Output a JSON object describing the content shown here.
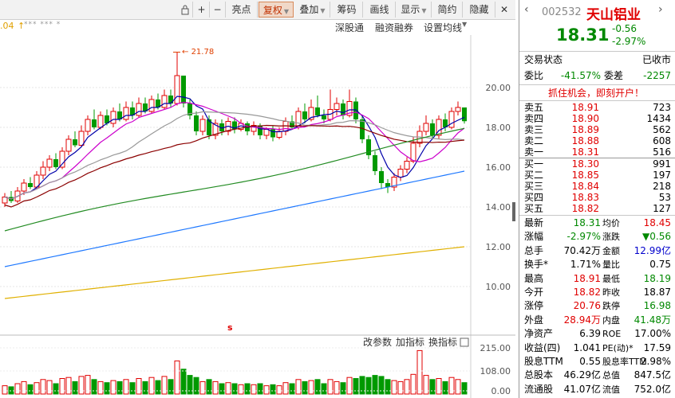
{
  "toolbar": {
    "items": [
      {
        "label": "亮点"
      },
      {
        "label": "复权",
        "active": true
      },
      {
        "label": "叠加"
      },
      {
        "label": "筹码"
      },
      {
        "label": "画线"
      },
      {
        "label": "显示"
      },
      {
        "label": "简约"
      },
      {
        "label": "隐藏"
      }
    ]
  },
  "subbar": {
    "price_marker": ".04",
    "items": [
      "深股通",
      "融资融券",
      "设置均线"
    ]
  },
  "chart": {
    "y_ticks": [
      "20.00",
      "18.00",
      "16.00",
      "14.00",
      "12.00",
      "10.00"
    ],
    "high_label": "21.78",
    "marker": "s",
    "volume_tabs": [
      "改参数",
      "加指标",
      "换指标"
    ],
    "vol_ticks": [
      "215.00",
      "108.00",
      "0.00"
    ],
    "colors": {
      "up": "#e00000",
      "down": "#009900",
      "ma5": "#0000aa",
      "ma10": "#cc00cc",
      "ma20": "#999999",
      "ma30": "#8b0000",
      "ma60": "#228b22",
      "ma120": "#1e78ff",
      "ma250": "#e0b000"
    }
  },
  "quote": {
    "code": "002532",
    "name": "天山铝业",
    "price": "18.31",
    "change": "-0.56",
    "change_pct": "-2.97%",
    "status_label": "交易状态",
    "status_value": "已收市",
    "weibi_label": "委比",
    "weibi_value": "-41.57%",
    "weicha_label": "委差",
    "weicha_value": "-2257",
    "ad": "抓住机会，即刻开户！",
    "asks": [
      {
        "label": "卖五",
        "price": "18.91",
        "vol": "723"
      },
      {
        "label": "卖四",
        "price": "18.90",
        "vol": "1434"
      },
      {
        "label": "卖三",
        "price": "18.89",
        "vol": "562"
      },
      {
        "label": "卖二",
        "price": "18.88",
        "vol": "608"
      },
      {
        "label": "卖一",
        "price": "18.31",
        "vol": "516"
      }
    ],
    "bids": [
      {
        "label": "买一",
        "price": "18.30",
        "vol": "991"
      },
      {
        "label": "买二",
        "price": "18.85",
        "vol": "197"
      },
      {
        "label": "买三",
        "price": "18.84",
        "vol": "218"
      },
      {
        "label": "买四",
        "price": "18.83",
        "vol": "53"
      },
      {
        "label": "买五",
        "price": "18.82",
        "vol": "127"
      }
    ],
    "stats": [
      {
        "l1": "最新",
        "v1": "18.31",
        "c1": "green",
        "l2": "均价",
        "v2": "18.45",
        "c2": "red"
      },
      {
        "l1": "涨幅",
        "v1": "-2.97%",
        "c1": "green",
        "l2": "涨跌",
        "v2": "▼0.56",
        "c2": "green"
      },
      {
        "l1": "总手",
        "v1": "70.42万",
        "c1": "",
        "l2": "金额",
        "v2": "12.99亿",
        "c2": "blue"
      },
      {
        "l1": "换手*",
        "v1": "1.71%",
        "c1": "",
        "l2": "量比",
        "v2": "0.75",
        "c2": ""
      },
      {
        "l1": "最高",
        "v1": "18.91",
        "c1": "red",
        "l2": "最低",
        "v2": "18.19",
        "c2": "green"
      },
      {
        "l1": "今开",
        "v1": "18.82",
        "c1": "red",
        "l2": "昨收",
        "v2": "18.87",
        "c2": ""
      },
      {
        "l1": "涨停",
        "v1": "20.76",
        "c1": "red",
        "l2": "跌停",
        "v2": "16.98",
        "c2": "green"
      },
      {
        "l1": "外盘",
        "v1": "28.94万",
        "c1": "red",
        "l2": "内盘",
        "v2": "41.48万",
        "c2": "green"
      },
      {
        "l1": "净资产",
        "v1": "6.39",
        "c1": "",
        "l2": "ROE",
        "v2": "17.00%",
        "c2": ""
      },
      {
        "l1": "收益(四)",
        "v1": "1.041",
        "c1": "",
        "l2": "PE(动)*",
        "v2": "17.59",
        "c2": ""
      },
      {
        "l1": "股息TTM",
        "v1": "0.55",
        "c1": "",
        "l2": "股息率TTM",
        "v2": "2.98%",
        "c2": ""
      },
      {
        "l1": "总股本",
        "v1": "46.29亿",
        "c1": "",
        "l2": "总值",
        "v2": "847.5亿",
        "c2": ""
      },
      {
        "l1": "流通股",
        "v1": "41.07亿",
        "c1": "",
        "l2": "流值",
        "v2": "752.0亿",
        "c2": ""
      }
    ]
  }
}
